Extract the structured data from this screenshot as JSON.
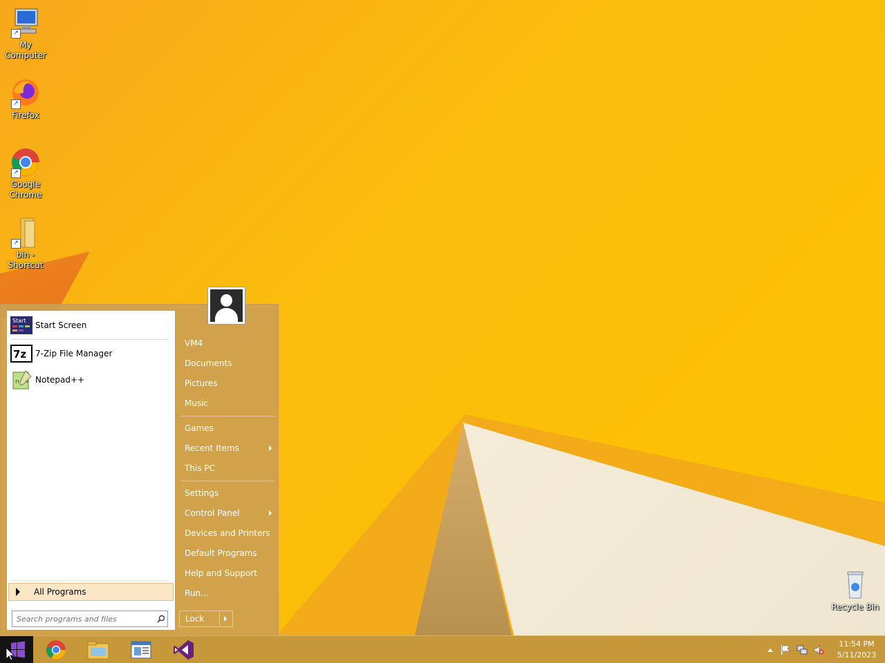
{
  "desktop": {
    "icons": [
      {
        "label": "My Computer",
        "icon": "computer-icon"
      },
      {
        "label": "Firefox",
        "icon": "firefox-icon"
      },
      {
        "label": "Google Chrome",
        "icon": "chrome-icon"
      },
      {
        "label": "bin - Shortcut",
        "icon": "folder-icon"
      },
      {
        "label": "Recycle Bin",
        "icon": "recycle-bin-icon"
      }
    ]
  },
  "start_menu": {
    "programs": [
      {
        "label": "Start Screen",
        "icon": "start-screen-icon"
      },
      {
        "label": "7-Zip File Manager",
        "icon": "7zip-icon"
      },
      {
        "label": "Notepad++",
        "icon": "notepadpp-icon"
      }
    ],
    "all_programs": "All Programs",
    "search_placeholder": "Search programs and files",
    "user_name": "VM4",
    "right_items": {
      "documents": "Documents",
      "pictures": "Pictures",
      "music": "Music",
      "games": "Games",
      "recent_items": "Recent Items",
      "this_pc": "This PC",
      "settings": "Settings",
      "control_panel": "Control Panel",
      "devices_printers": "Devices and Printers",
      "default_programs": "Default Programs",
      "help_support": "Help and Support",
      "run": "Run..."
    },
    "lock_label": "Lock"
  },
  "taskbar": {
    "pinned": [
      "chrome-icon",
      "file-explorer-icon",
      "control-panel-icon",
      "visual-studio-icon"
    ],
    "time": "11:54 PM",
    "date": "5/11/2023"
  },
  "colors": {
    "wallpaper": "#fbbd0c",
    "menu_tint": "#cda050",
    "all_programs_highlight": "#fbe7c6"
  }
}
